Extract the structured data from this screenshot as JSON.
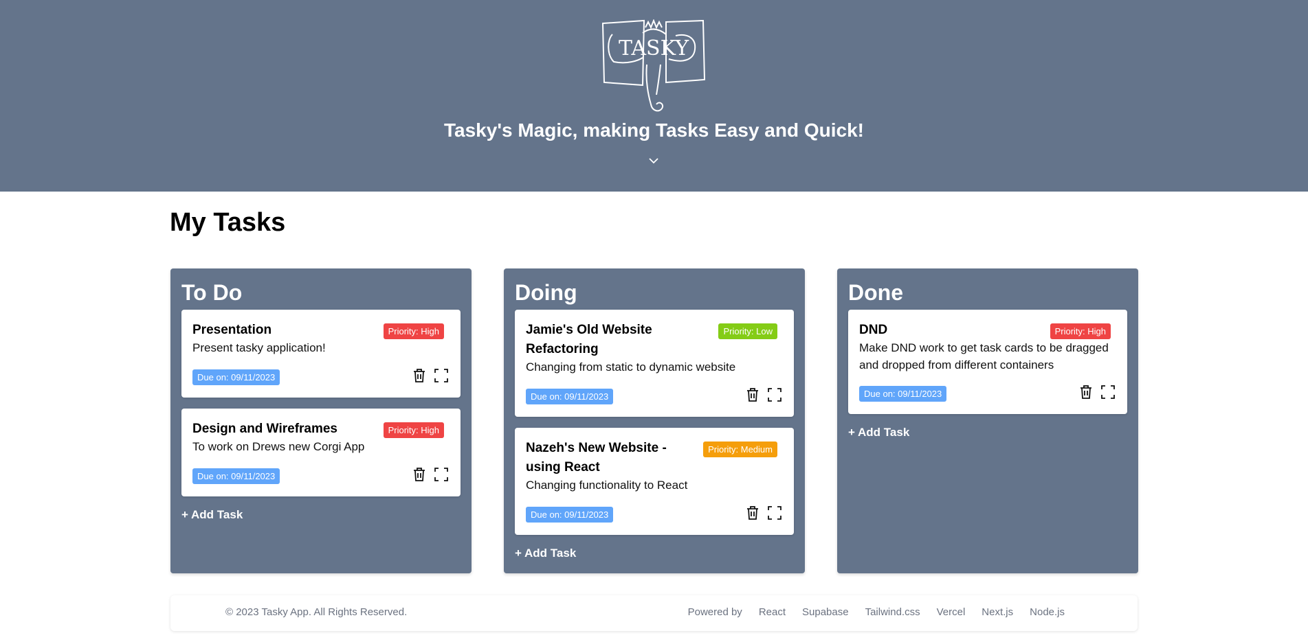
{
  "header": {
    "logo_text": "TASKY",
    "tagline": "Tasky's Magic, making Tasks Easy and Quick!"
  },
  "page_title": "My Tasks",
  "columns": [
    {
      "title": "To Do",
      "add_label": "+ Add Task",
      "cards": [
        {
          "title": "Presentation",
          "description": "Present tasky application!",
          "priority": "Priority: High",
          "due": "Due on: 09/11/2023"
        },
        {
          "title": "Design and Wireframes",
          "description": "To work on Drews new Corgi App",
          "priority": "Priority: High",
          "due": "Due on: 09/11/2023"
        }
      ]
    },
    {
      "title": "Doing",
      "add_label": "+ Add Task",
      "cards": [
        {
          "title_line1": "Jamie's Old Website",
          "title_line2": "Refactoring",
          "description": "Changing from static to dynamic website",
          "priority": "Priority: Low",
          "due": "Due on: 09/11/2023"
        },
        {
          "title_line1": "Nazeh's New Website -",
          "title_line2": "using React",
          "description": "Changing functionality to React",
          "priority": "Priority: Medium",
          "due": "Due on: 09/11/2023"
        }
      ]
    },
    {
      "title": "Done",
      "add_label": "+ Add Task",
      "cards": [
        {
          "title": "DND",
          "description_line1": "Make DND work to get task cards to be dragged",
          "description_line2": "and dropped from different containers",
          "priority": "Priority: High",
          "due": "Due on: 09/11/2023"
        }
      ]
    }
  ],
  "footer": {
    "copyright": "© 2023 Tasky App. All Rights Reserved.",
    "powered_by": "Powered by",
    "links": [
      "React",
      "Supabase",
      "Tailwind.css",
      "Vercel",
      "Next.js",
      "Node.js"
    ]
  },
  "colors": {
    "header_bg": "#64748b",
    "priority_high": "#ef4444",
    "priority_low": "#84cc16",
    "priority_medium": "#f59e0b",
    "due_badge": "#60a5fa"
  },
  "icons": [
    "tasky-logo",
    "chevron-down-icon",
    "trash-icon",
    "expand-icon"
  ]
}
